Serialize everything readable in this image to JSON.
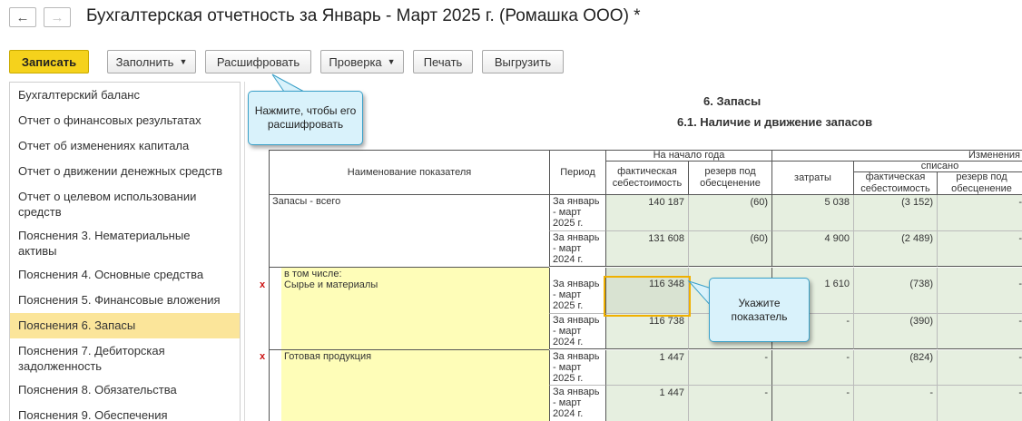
{
  "window": {
    "title": "Бухгалтерская отчетность за Январь - Март 2025 г. (Ромашка ООО) *",
    "back_icon": "arrow-left-icon",
    "forward_icon": "arrow-right-icon"
  },
  "toolbar": {
    "save": "Записать",
    "fill": "Заполнить",
    "decode": "Расшифровать",
    "check": "Проверка",
    "print": "Печать",
    "export": "Выгрузить"
  },
  "sidebar": {
    "items": [
      {
        "label": "Бухгалтерский баланс",
        "active": false
      },
      {
        "label": "Отчет о финансовых результатах",
        "active": false
      },
      {
        "label": "Отчет об изменениях капитала",
        "active": false
      },
      {
        "label": "Отчет о движении денежных средств",
        "active": false
      },
      {
        "label": "Отчет о целевом использовании средств",
        "active": false
      },
      {
        "label": "Пояснения 3. Нематериальные активы",
        "active": false
      },
      {
        "label": "Пояснения 4. Основные средства",
        "active": false
      },
      {
        "label": "Пояснения 5. Финансовые вложения",
        "active": false
      },
      {
        "label": "Пояснения 6. Запасы",
        "active": true
      },
      {
        "label": "Пояснения 7. Дебиторская задолженность",
        "active": false
      },
      {
        "label": "Пояснения 8. Обязательства",
        "active": false
      },
      {
        "label": "Пояснения 9. Обеспечения",
        "active": false
      }
    ]
  },
  "report": {
    "heading": "6. Запасы",
    "subheading": "6.1. Наличие и движение запасов",
    "headers": {
      "indicator": "Наименование показателя",
      "period": "Период",
      "start_of_year": "На начало года",
      "actual_cost": "фактическая себестоимость",
      "impairment_reserve": "резерв под обесценение",
      "changes": "Изменения",
      "costs": "затраты",
      "written_off": "списано",
      "wo_actual_cost": "фактическая себестоимость",
      "wo_reserve": "резерв под обесценение"
    },
    "rows": [
      {
        "name": "Запасы - всего",
        "period": "За январь - март 2025 г.",
        "c1": "140 187",
        "c2": "(60)",
        "c3": "5 038",
        "c4": "(3 152)",
        "c5": "-"
      },
      {
        "name": "",
        "period": "За январь - март 2024 г.",
        "c1": "131 608",
        "c2": "(60)",
        "c3": "4 900",
        "c4": "(2 489)",
        "c5": "-"
      },
      {
        "name": "в том числе:\nСырье и материалы",
        "period": "За январь - март 2025 г.",
        "c1": "116 348",
        "c2": "",
        "c3": "1 610",
        "c4": "(738)",
        "c5": "-"
      },
      {
        "name": "",
        "period": "За январь - март 2024 г.",
        "c1": "116 738",
        "c2": "",
        "c3": "-",
        "c4": "(390)",
        "c5": "-"
      },
      {
        "name": "Готовая продукция",
        "period": "За январь - март 2025 г.",
        "c1": "1 447",
        "c2": "-",
        "c3": "-",
        "c4": "(824)",
        "c5": "-"
      },
      {
        "name": "",
        "period": "За январь - март 2024 г.",
        "c1": "1 447",
        "c2": "-",
        "c3": "-",
        "c4": "-",
        "c5": "-"
      }
    ],
    "error_mark": "x"
  },
  "callouts": {
    "decode_hint": "Нажмите, чтобы его расшифровать",
    "indicator_hint": "Укажите показатель"
  },
  "colors": {
    "primary_button": "#f5d21c",
    "active_sidebar": "#fbe59a",
    "cell_green": "#e6efe0",
    "cell_yellow": "#fefdb8",
    "callout_bg": "#d9f2fb",
    "error_mark": "#cc1111"
  }
}
